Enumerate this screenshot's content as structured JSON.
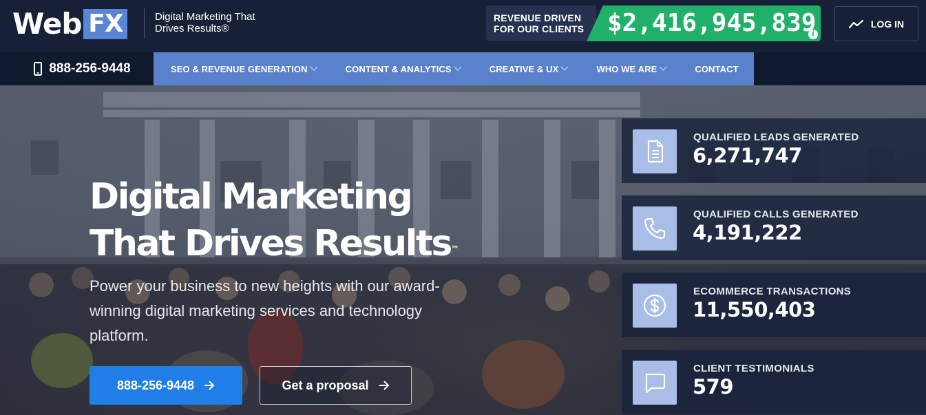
{
  "brand": {
    "logo_web": "Web",
    "logo_fx": "FX",
    "tagline": "Digital Marketing That Drives Results®"
  },
  "revenue": {
    "label_line1": "REVENUE DRIVEN",
    "label_line2": "FOR OUR CLIENTS",
    "value": "$2,416,945,839",
    "info_icon": "i"
  },
  "login": {
    "label": "LOG IN",
    "icon": "trend-line-icon"
  },
  "nav": {
    "phone": "888-256-9448",
    "items": [
      {
        "label": "SEO & REVENUE GENERATION",
        "has_dropdown": true
      },
      {
        "label": "CONTENT & ANALYTICS",
        "has_dropdown": true
      },
      {
        "label": "CREATIVE & UX",
        "has_dropdown": true
      },
      {
        "label": "WHO WE ARE",
        "has_dropdown": true
      },
      {
        "label": "CONTACT",
        "has_dropdown": false
      }
    ]
  },
  "hero": {
    "title_line1": "Digital Marketing",
    "title_line2": "That Drives Results",
    "trademark": "™",
    "subtitle": "Power your business to new heights with our award-winning digital marketing services and technology platform.",
    "cta_call": "888-256-9448",
    "cta_proposal": "Get a proposal"
  },
  "stats": [
    {
      "label": "QUALIFIED LEADS GENERATED",
      "value": "6,271,747",
      "icon": "document-icon"
    },
    {
      "label": "QUALIFIED CALLS GENERATED",
      "value": "4,191,222",
      "icon": "phone-icon"
    },
    {
      "label": "ECOMMERCE TRANSACTIONS",
      "value": "11,550,403",
      "icon": "dollar-icon"
    },
    {
      "label": "CLIENT TESTIMONIALS",
      "value": "579",
      "icon": "chat-bubble-icon"
    }
  ],
  "colors": {
    "nav_blue": "#5a82cc",
    "dark_navy": "#172036",
    "revenue_green": "#21b06a",
    "cta_blue": "#1f7ee8",
    "stat_icon_bg": "#a9bee6"
  }
}
